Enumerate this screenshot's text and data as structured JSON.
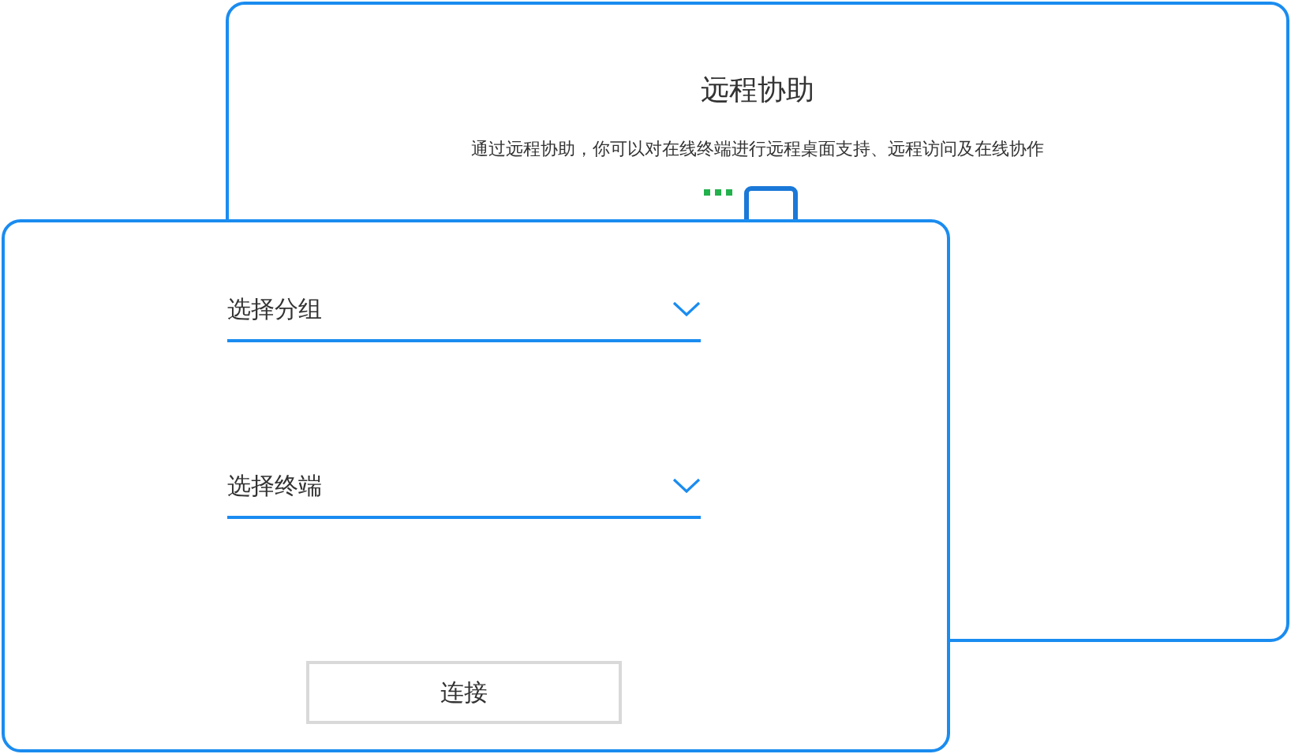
{
  "remote_panel": {
    "title": "远程协助",
    "description": "通过远程协助，你可以对在线终端进行远程桌面支持、远程访问及在线协作"
  },
  "connect_dialog": {
    "fields": [
      {
        "placeholder": "选择分组"
      },
      {
        "placeholder": "选择终端"
      }
    ],
    "connect_button": "连接"
  }
}
